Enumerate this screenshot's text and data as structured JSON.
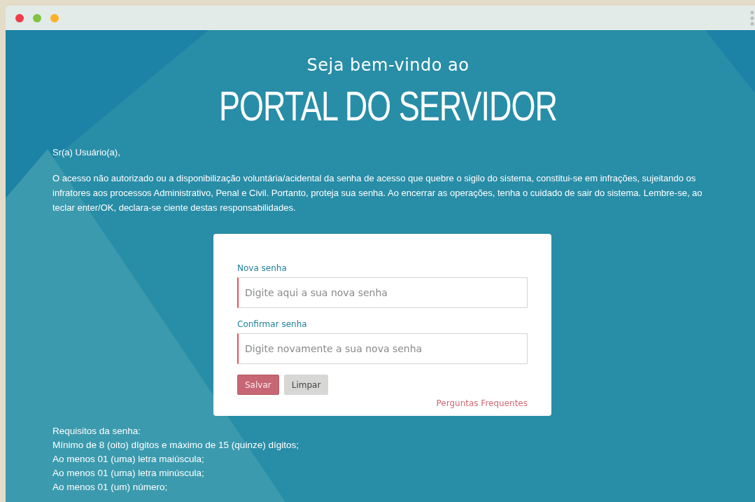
{
  "window": {
    "controls": [
      {
        "color": "#ef3d4a"
      },
      {
        "color": "#82c341"
      },
      {
        "color": "#fbb12a"
      }
    ]
  },
  "header": {
    "subtitle": "Seja bem-vindo ao",
    "title": "PORTAL DO SERVIDOR"
  },
  "intro": [
    "Sr(a) Usuário(a),",
    "O acesso não autorizado ou a disponibilização voluntária/acidental da senha de acesso que quebre o sigilo do sistema, constitui-se em infrações, sujeitando os infratores aos processos Administrativo, Penal e Civil. Portanto, proteja sua senha. Ao encerrar as operações, tenha o cuidado de sair do sistema. Lembre-se, ao teclar enter/OK, declara-se ciente destas responsabilidades."
  ],
  "form": {
    "fields": [
      {
        "label": "Nova senha",
        "placeholder": "Digite aqui a sua nova senha",
        "invalid": true
      },
      {
        "label": "Confirmar senha",
        "placeholder": "Digite novamente a sua nova senha",
        "invalid": true
      }
    ],
    "buttons": [
      {
        "label": "Salvar",
        "kind": "primary"
      },
      {
        "label": "Limpar",
        "kind": "secondary"
      }
    ],
    "link": "Perguntas Frequentes"
  },
  "requirements": [
    "Requisitos da senha:",
    "Mínimo de 8 (oito) dígitos e máximo de 15 (quinze) dígitos;",
    "Ao menos 01 (uma) letra maiúscula;",
    "Ao menos 01 (uma) letra minúscula;",
    "Ao menos 01 (um) número;"
  ]
}
